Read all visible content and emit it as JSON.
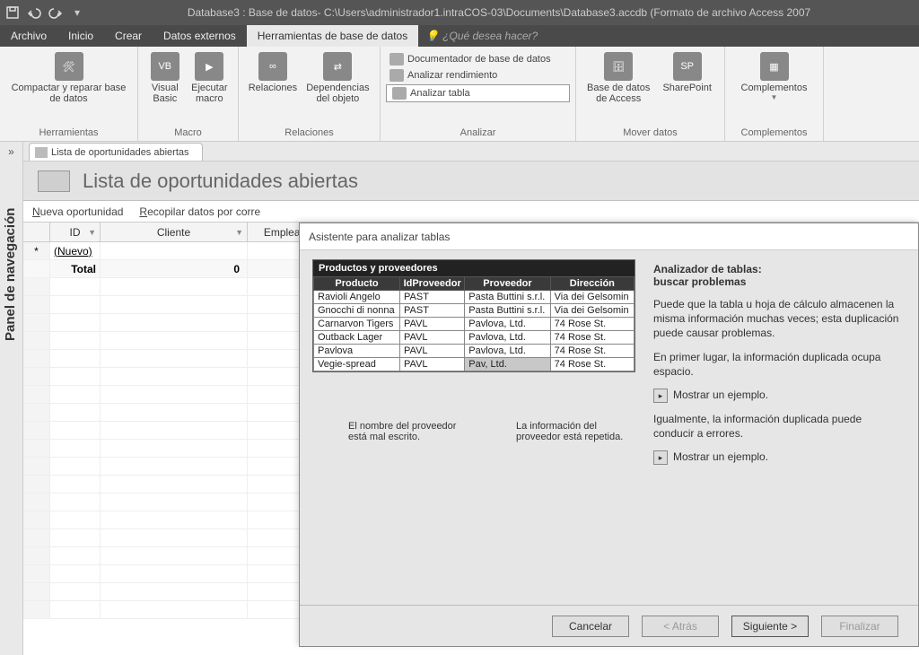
{
  "titlebar": {
    "title": "Database3 : Base de datos- C:\\Users\\administrador1.intraCOS-03\\Documents\\Database3.accdb (Formato de archivo Access 2007"
  },
  "menu": {
    "archivo": "Archivo",
    "inicio": "Inicio",
    "crear": "Crear",
    "datos_externos": "Datos externos",
    "herramientas_bd": "Herramientas de base de datos",
    "tell_me": "¿Qué desea hacer?"
  },
  "ribbon": {
    "compactar": "Compactar y reparar base de datos",
    "grp_herramientas": "Herramientas",
    "visual_basic": "Visual Basic",
    "ejecutar_macro": "Ejecutar macro",
    "grp_macro": "Macro",
    "relaciones": "Relaciones",
    "dependencias": "Dependencias del objeto",
    "grp_relaciones": "Relaciones",
    "documentador": "Documentador de base de datos",
    "analizar_rend": "Analizar rendimiento",
    "analizar_tabla": "Analizar tabla",
    "grp_analizar": "Analizar",
    "bd_access": "Base de datos de Access",
    "sharepoint": "SharePoint",
    "grp_mover": "Mover datos",
    "complementos": "Complementos",
    "grp_complementos": "Complementos"
  },
  "doc": {
    "tab": "Lista de oportunidades abiertas",
    "header": "Lista de oportunidades abiertas",
    "nueva": "Nueva oportunidad",
    "recopilar": "Recopilar datos por corre",
    "col_id": "ID",
    "col_cliente": "Cliente",
    "col_empleado": "Emplead",
    "nuevo": "(Nuevo)",
    "total": "Total",
    "total_val": "0"
  },
  "wizard": {
    "title": "Asistente para analizar tablas",
    "sample_title": "Productos y proveedores",
    "th_producto": "Producto",
    "th_idprov": "IdProveedor",
    "th_prov": "Proveedor",
    "th_dir": "Dirección",
    "rows": [
      {
        "p": "Ravioli Angelo",
        "i": "PAST",
        "v": "Pasta Buttini s.r.l.",
        "d": "Via dei Gelsomin"
      },
      {
        "p": "Gnocchi di nonna",
        "i": "PAST",
        "v": "Pasta Buttini s.r.l.",
        "d": "Via dei Gelsomin"
      },
      {
        "p": "Carnarvon Tigers",
        "i": "PAVL",
        "v": "Pavlova, Ltd.",
        "d": "74 Rose St."
      },
      {
        "p": "Outback Lager",
        "i": "PAVL",
        "v": "Pavlova, Ltd.",
        "d": "74 Rose St."
      },
      {
        "p": "Pavlova",
        "i": "PAVL",
        "v": "Pavlova, Ltd.",
        "d": "74 Rose St."
      },
      {
        "p": "Vegie-spread",
        "i": "PAVL",
        "v": "Pav, Ltd.",
        "d": "74 Rose St."
      }
    ],
    "callout1": "El nombre del proveedor está mal escrito.",
    "callout2": "La información del proveedor está repetida.",
    "h1a": "Analizador de tablas:",
    "h1b": "buscar problemas",
    "p1": "Puede que la tabla u hoja de cálculo almacenen la misma información muchas veces; esta duplicación puede causar problemas.",
    "p2": "En primer lugar, la información duplicada ocupa espacio.",
    "ej": "Mostrar un ejemplo.",
    "p3": "Igualmente, la información duplicada puede conducir a errores.",
    "btn_cancel": "Cancelar",
    "btn_back": "< Atrás",
    "btn_next": "Siguiente >",
    "btn_finish": "Finalizar"
  },
  "nav": {
    "panel": "Panel de navegación"
  }
}
